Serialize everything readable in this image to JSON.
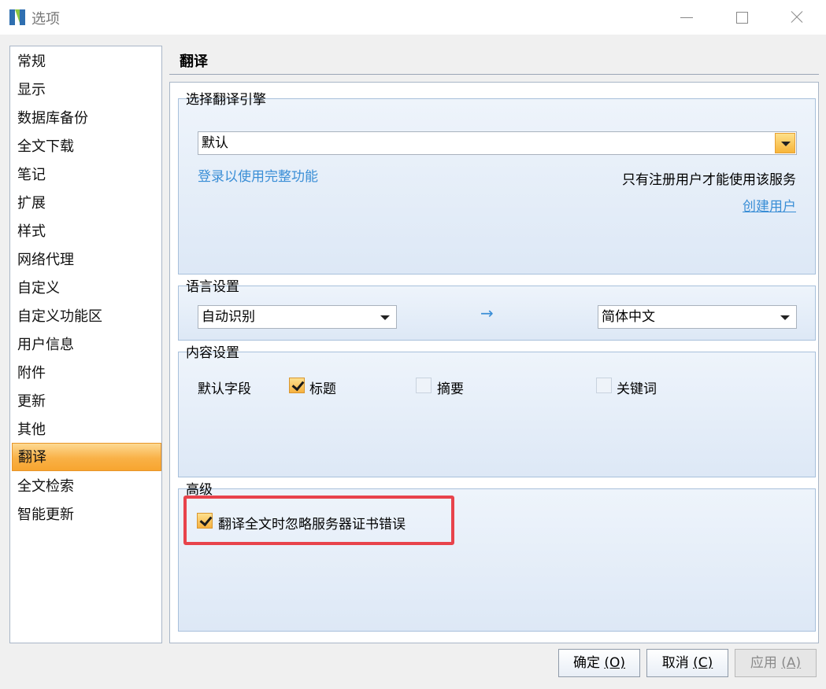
{
  "window": {
    "title": "选项"
  },
  "nav": {
    "items": [
      {
        "label": "常规"
      },
      {
        "label": "显示"
      },
      {
        "label": "数据库备份"
      },
      {
        "label": "全文下载"
      },
      {
        "label": "笔记"
      },
      {
        "label": "扩展"
      },
      {
        "label": "样式"
      },
      {
        "label": "网络代理"
      },
      {
        "label": "自定义"
      },
      {
        "label": "自定义功能区"
      },
      {
        "label": "用户信息"
      },
      {
        "label": "附件"
      },
      {
        "label": "更新"
      },
      {
        "label": "其他"
      },
      {
        "label": "翻译",
        "active": true
      },
      {
        "label": "全文检索"
      },
      {
        "label": "智能更新"
      }
    ]
  },
  "page": {
    "title": "翻译"
  },
  "engine": {
    "label": "选择翻译引擎",
    "selected": "默认",
    "login_link": "登录以使用完整功能",
    "notice": "只有注册用户才能使用该服务",
    "create_user_link": "创建用户"
  },
  "language": {
    "label": "语言设置",
    "source": "自动识别",
    "arrow": "→",
    "target": "简体中文"
  },
  "content_settings": {
    "label": "内容设置",
    "field_label": "默认字段",
    "options": [
      {
        "label": "标题",
        "checked": true
      },
      {
        "label": "摘要",
        "checked": false
      },
      {
        "label": "关键词",
        "checked": false
      }
    ]
  },
  "advanced": {
    "label": "高级",
    "ignore_cert_label": "翻译全文时忽略服务器证书错误",
    "ignore_cert_checked": true
  },
  "buttons": {
    "ok": "确定",
    "ok_key": "(O)",
    "cancel": "取消",
    "cancel_key": "(C)",
    "apply": "应用",
    "apply_key": "(A)"
  },
  "colors": {
    "accent_orange": "#f9b147",
    "link_blue": "#3a8ed6",
    "highlight_red": "#e8434b"
  }
}
